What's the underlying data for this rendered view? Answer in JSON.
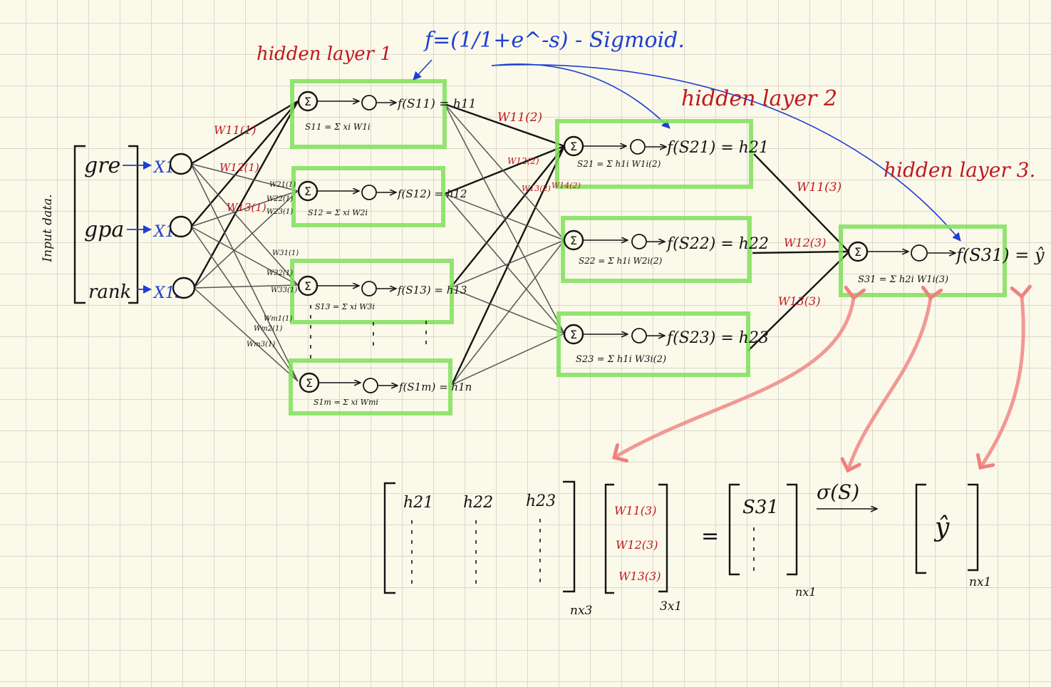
{
  "input": {
    "side_label": "Input data.",
    "features": [
      "gre",
      "gpa",
      "rank"
    ],
    "nodes": [
      "X11",
      "X12",
      "X13"
    ]
  },
  "sigmoid_note": "f=(1/1+e^-s) - Sigmoid.",
  "hidden1": {
    "title": "hidden layer 1",
    "outputs": [
      "f(S11) = h11",
      "f(S12) = h12",
      "f(S13) = h13",
      "f(S1m) = h1n"
    ],
    "sums": [
      "S11 = Σ xi W1i",
      "S12 = Σ xi W2i",
      "S13 = Σ xi W3i",
      "S1m = Σ xi Wmi"
    ],
    "weights": [
      "W11(1)",
      "W12(1)",
      "W13(1)",
      "W21(1)",
      "W22(1)",
      "W23(1)",
      "W31(1)",
      "W32(1)",
      "W33(1)",
      "Wm1(1)",
      "Wm2(1)",
      "Wm3(1)"
    ]
  },
  "hidden2": {
    "title": "hidden layer 2",
    "outputs": [
      "f(S21) = h21",
      "f(S22) = h22",
      "f(S23) = h23"
    ],
    "sums": [
      "S21 = Σ h1i W1i(2)",
      "S22 = Σ h1i W2i(2)",
      "S23 = Σ h1i W3i(2)"
    ],
    "weights": [
      "W11(2)",
      "W12(2)",
      "W13(2)",
      "W14(2)"
    ]
  },
  "hidden3": {
    "title": "hidden layer 3.",
    "output": "f(S31) = ŷ",
    "sum": "S31 = Σ h2i W1i(3)",
    "weights": [
      "W11(3)",
      "W12(3)",
      "W13(3)"
    ]
  },
  "matrix": {
    "h_headers": [
      "h21",
      "h22",
      "h23"
    ],
    "h_dim": "nx3",
    "w_entries": [
      "W11(3)",
      "W12(3)",
      "W13(3)"
    ],
    "w_dim": "3x1",
    "equals": "=",
    "s_entry": "S31",
    "s_dim": "nx1",
    "activation": "σ(S)",
    "y_entry": "ŷ",
    "y_dim": "nx1"
  },
  "colors": {
    "ink": "#141414",
    "red_annotations": "#c0181e",
    "blue_annotations": "#1f3fd0",
    "highlight_boxes": "#7fe05a",
    "pink_arrows": "#f08080",
    "paper": "#fbf9ea"
  }
}
